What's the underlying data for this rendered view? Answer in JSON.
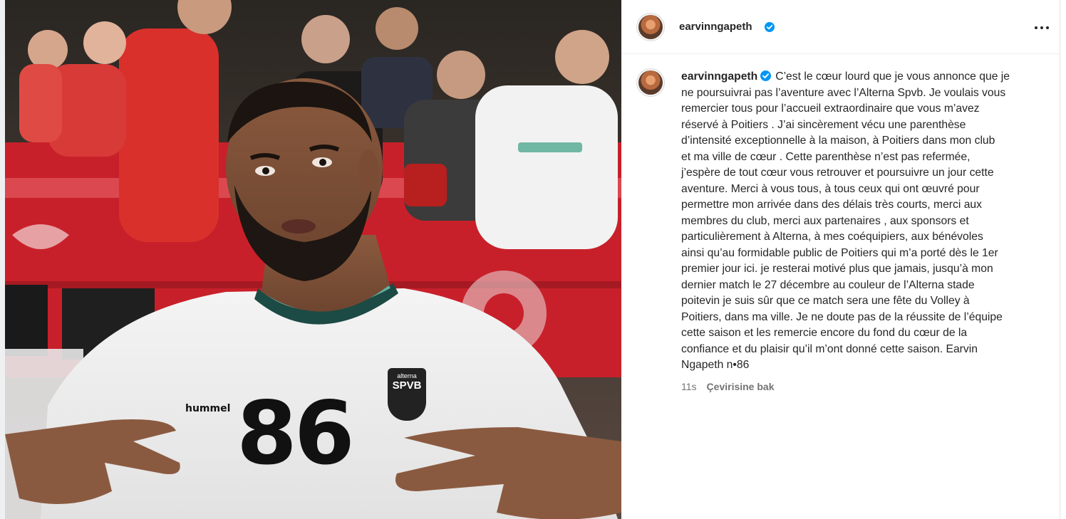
{
  "post": {
    "username": "earvinngapeth",
    "verified": true,
    "caption_username": "earvinngapeth",
    "caption_text": "C’est le cœur lourd que je vous annonce que je\nne poursuivrai pas l’aventure avec l’Alterna Spvb. Je voulais vous\nremercier tous pour l’accueil extraordinaire que vous m’avez\nréservé à Poitiers . J’ai sincèrement vécu une parenthèse\nd’intensité exceptionnelle à la maison, à Poitiers dans mon club\net ma ville de cœur . Cette parenthèse n’est pas refermée,\nj’espère de tout cœur vous retrouver et poursuivre un jour cette\naventure. Merci à vous tous, à tous ceux qui ont œuvré pour\npermettre mon arrivée dans des délais très courts, merci aux\nmembres du club, merci aux partenaires , aux sponsors et\nparticulièrement à Alterna, à mes coéquipiers, aux bénévoles\nainsi qu’au formidable public de Poitiers qui m’a porté dès le 1er\npremier jour ici. je resterai motivé plus que jamais, jusqu’à mon\ndernier match le 27 décembre au couleur de l’Alterna stade\npoitevin je suis sûr que ce match sera une fête du Volley à\nPoitiers, dans ma ville. Je ne doute pas de la réussite de l’équipe\ncette saison et les remercie encore du fond du cœur de la\nconfiance et du plaisir qu’il m’ont donné cette saison. Earvin\nNgapeth n•86",
    "timestamp": "11s",
    "see_translation": "Çevirisine bak"
  },
  "photo": {
    "jersey_number": "86",
    "jersey_brand": "hummel",
    "crest_top": "alterna",
    "crest_main": "SPVB"
  },
  "colors": {
    "verified_blue": "#0095f6",
    "text": "#262626",
    "secondary": "#737373",
    "banner_red": "#c8202a"
  },
  "icons": {
    "more": "more-horizontal-icon",
    "verified": "verified-badge-icon"
  }
}
